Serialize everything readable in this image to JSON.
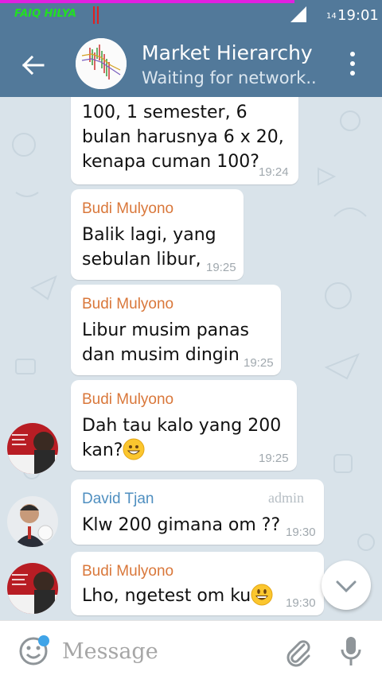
{
  "status_bar": {
    "carrier": "FAIQ HILYA",
    "network_type": "14",
    "time": "19:01"
  },
  "header": {
    "title": "Market Hierarchy",
    "subtitle": "Waiting for network..",
    "back_icon": "arrow-left-icon",
    "menu_icon": "more-vert-icon"
  },
  "messages": [
    {
      "sender": "",
      "lines": [
        "100, 1 semester, 6",
        "bulan harusnya 6 x 20,",
        "kenapa cuman 100?"
      ],
      "time": "19:24"
    },
    {
      "sender": "Budi Mulyono",
      "lines": [
        "Balik lagi, yang",
        "sebulan libur,"
      ],
      "time": "19:25"
    },
    {
      "sender": "Budi Mulyono",
      "lines": [
        "Libur musim panas",
        "dan musim dingin"
      ],
      "time": "19:25"
    },
    {
      "sender": "Budi Mulyono",
      "lines": [
        "Dah tau kalo yang 200",
        "kan?"
      ],
      "time": "19:25",
      "emoji": "smiling-emoji"
    },
    {
      "sender": "David Tjan",
      "badge": "admin",
      "lines": [
        "Klw 200 gimana om ??"
      ],
      "time": "19:30"
    },
    {
      "sender": "Budi Mulyono",
      "lines": [
        "Lho, ngetest om ku"
      ],
      "time": "19:30",
      "emoji": "grinning-emoji"
    }
  ],
  "input": {
    "placeholder": "Message",
    "emoji_icon": "smiley-icon",
    "attach_icon": "paperclip-icon",
    "mic_icon": "microphone-icon"
  },
  "colors": {
    "header": "#52799a",
    "sender_orange": "#d9773a",
    "sender_blue": "#4f8fc0",
    "chat_background": "#d9e3ea"
  }
}
